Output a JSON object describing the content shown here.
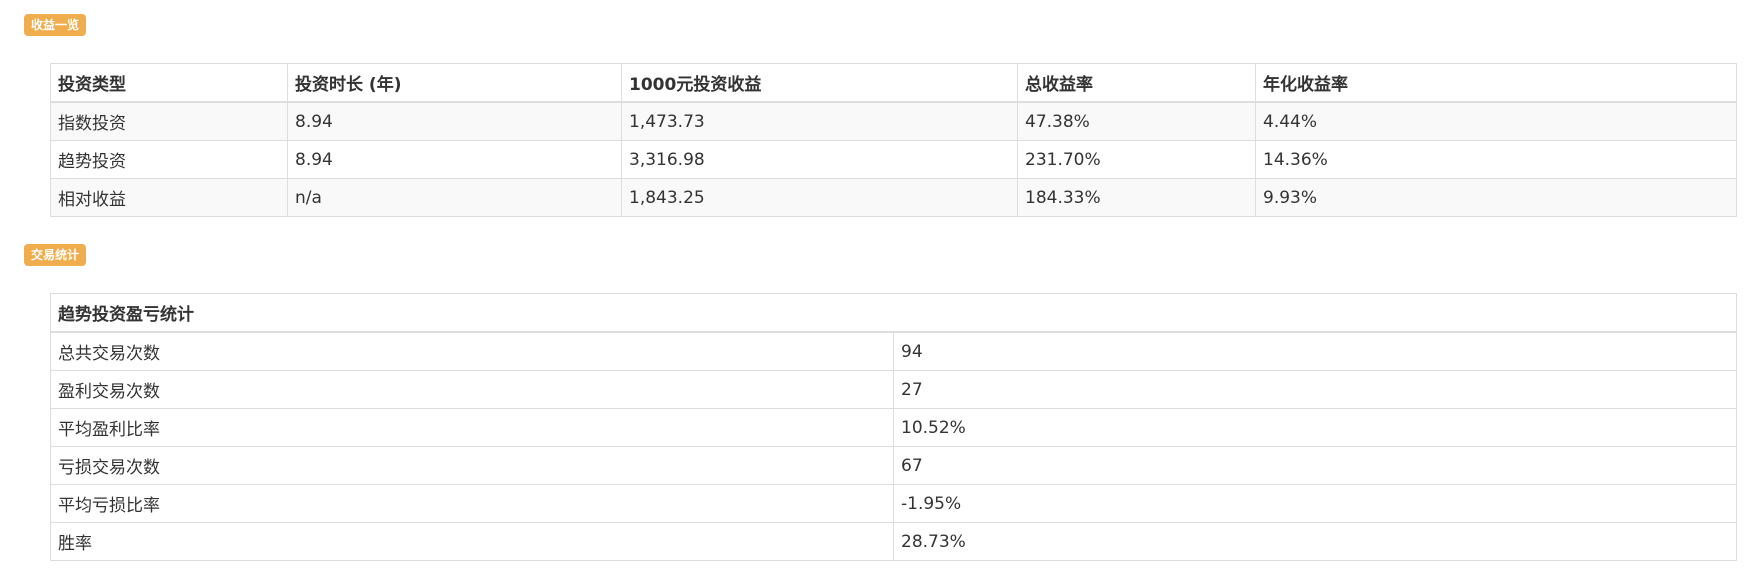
{
  "sections": {
    "returns_title": "收益一览",
    "trades_title": "交易统计"
  },
  "returns_table": {
    "headers": [
      "投资类型",
      "投资时长 (年)",
      "1000元投资收益",
      "总收益率",
      "年化收益率"
    ],
    "rows": [
      [
        "指数投资",
        "8.94",
        "1,473.73",
        "47.38%",
        "4.44%"
      ],
      [
        "趋势投资",
        "8.94",
        "3,316.98",
        "231.70%",
        "14.36%"
      ],
      [
        "相对收益",
        "n/a",
        "1,843.25",
        "184.33%",
        "9.93%"
      ]
    ]
  },
  "trades_table": {
    "title": "趋势投资盈亏统计",
    "rows": [
      [
        "总共交易次数",
        "94"
      ],
      [
        "盈利交易次数",
        "27"
      ],
      [
        "平均盈利比率",
        "10.52%"
      ],
      [
        "亏损交易次数",
        "67"
      ],
      [
        "平均亏损比率",
        "-1.95%"
      ],
      [
        "胜率",
        "28.73%"
      ]
    ]
  },
  "colors": {
    "badge": "#f0ad4e",
    "border": "#dddddd",
    "stripe": "#f9f9f9",
    "text": "#333333"
  }
}
